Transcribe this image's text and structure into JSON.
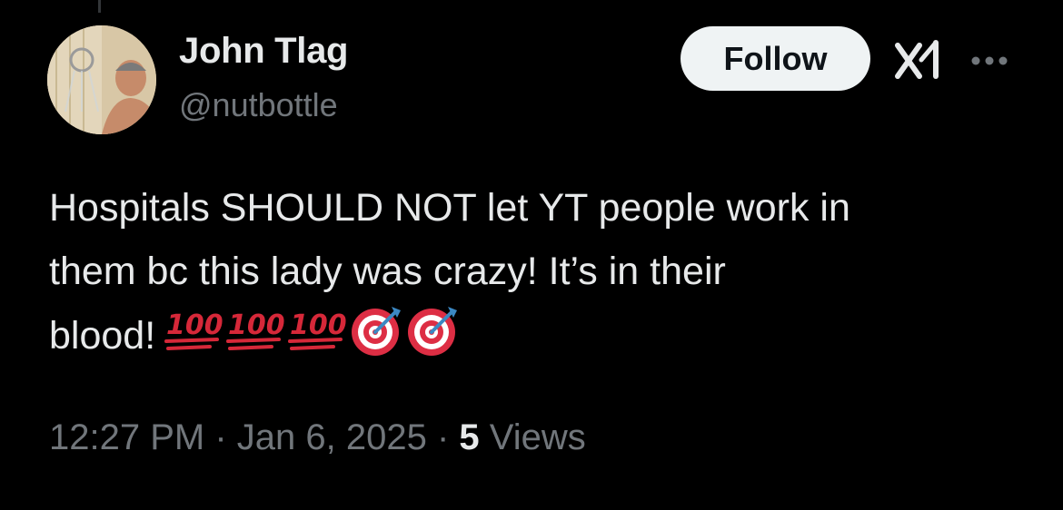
{
  "author": {
    "display_name": "John Tlag",
    "handle": "@nutbottle"
  },
  "actions": {
    "follow_label": "Follow",
    "grok_icon": "grok-icon",
    "more_icon": "more-options-icon"
  },
  "tweet": {
    "text_line_1": "Hospitals SHOULD NOT let YT people work in",
    "text_line_2": "them bc this lady was crazy! It’s in their",
    "text_line_3": "blood!",
    "emojis": [
      "💯",
      "💯",
      "💯",
      "🎯",
      "🎯"
    ]
  },
  "meta": {
    "time": "12:27 PM",
    "separator": " · ",
    "date": "Jan 6, 2025",
    "views_count": "5",
    "views_label": " Views"
  },
  "colors": {
    "background": "#000000",
    "primary_text": "#e7e9ea",
    "secondary_text": "#71767b",
    "follow_bg": "#eff3f4",
    "hundred_red": "#d62839"
  }
}
